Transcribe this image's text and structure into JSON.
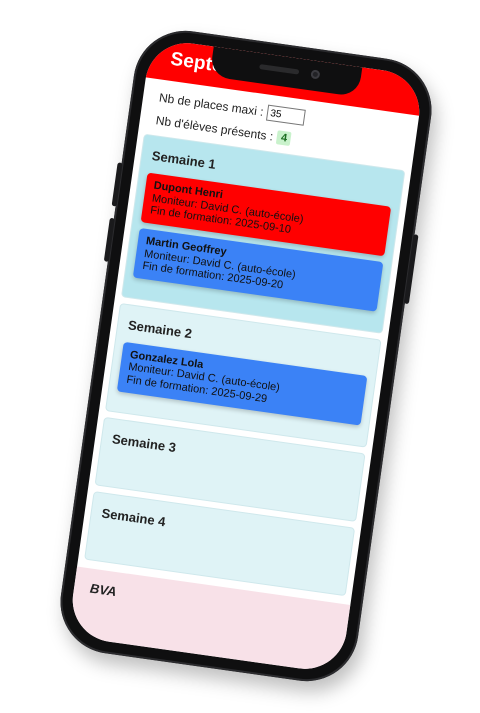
{
  "header": {
    "month": "Septembre"
  },
  "fields": {
    "max_places_label": "Nb de places maxi :",
    "max_places_value": "35",
    "present_label": "Nb d'élèves présents :",
    "present_count": "4"
  },
  "weeks": [
    {
      "title": "Semaine 1",
      "students": [
        {
          "name": "Dupont Henri",
          "monitor": "Moniteur: David C. (auto-école)",
          "end": "Fin de formation: 2025-09-10",
          "color": "#ff0000"
        },
        {
          "name": "Martin Geoffrey",
          "monitor": "Moniteur: David C. (auto-école)",
          "end": "Fin de formation: 2025-09-20",
          "color": "#3b82f6"
        }
      ]
    },
    {
      "title": "Semaine 2",
      "students": [
        {
          "name": "Gonzalez Lola",
          "monitor": "Moniteur: David C. (auto-école)",
          "end": "Fin de formation: 2025-09-29",
          "color": "#3b82f6"
        }
      ]
    },
    {
      "title": "Semaine 3",
      "students": []
    },
    {
      "title": "Semaine 4",
      "students": []
    }
  ],
  "bva": {
    "label": "BVA"
  },
  "colors": {
    "accent_red": "#ff0000",
    "card_blue": "#3b82f6",
    "week_bg": "#dff3f6",
    "bva_bg": "#f8e1e8"
  }
}
